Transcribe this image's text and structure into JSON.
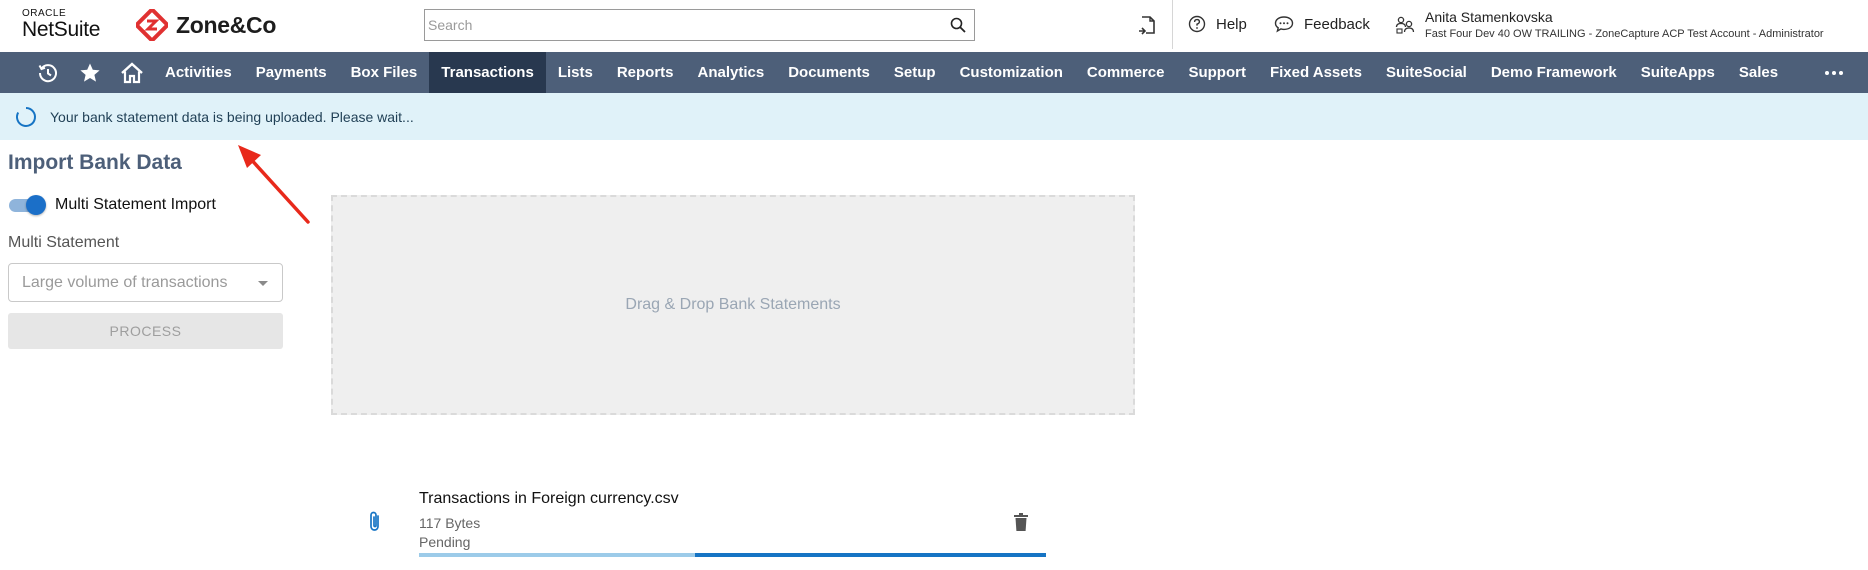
{
  "header": {
    "oracle_label": "ORACLE",
    "netsuite_label": "NetSuite",
    "brand_name": "Zone&Co",
    "search_placeholder": "Search",
    "help_label": "Help",
    "feedback_label": "Feedback",
    "user_name": "Anita Stamenkovska",
    "user_account": "Fast Four Dev 40 OW TRAILING - ZoneCapture ACP Test Account - Administrator"
  },
  "nav": {
    "icons": [
      "recent-records-icon",
      "star-icon",
      "home-icon"
    ],
    "items": [
      "Activities",
      "Payments",
      "Box Files",
      "Transactions",
      "Lists",
      "Reports",
      "Analytics",
      "Documents",
      "Setup",
      "Customization",
      "Commerce",
      "Support",
      "Fixed Assets",
      "SuiteSocial",
      "Demo Framework",
      "SuiteApps",
      "Sales"
    ],
    "active": "Transactions",
    "more_icon": "ellipsis-icon"
  },
  "banner": {
    "message": "Your bank statement data is being uploaded. Please wait..."
  },
  "page": {
    "title": "Import Bank Data",
    "toggle_label": "Multi Statement Import",
    "toggle_on": true,
    "field_label": "Multi Statement",
    "select_value": "Large volume of transactions",
    "process_label": "PROCESS",
    "dropzone_label": "Drag & Drop Bank Statements"
  },
  "upload": {
    "file_name": "Transactions in Foreign currency.csv",
    "file_size": "117 Bytes",
    "status": "Pending",
    "progress_fill_fraction": 0.56
  },
  "colors": {
    "nav_bg": "#4d5f79",
    "nav_active": "#28384f",
    "banner_bg": "#e0f2f9",
    "accent_blue": "#1674c4",
    "brand_red": "#e03131",
    "annotation_red": "#e8291b"
  }
}
